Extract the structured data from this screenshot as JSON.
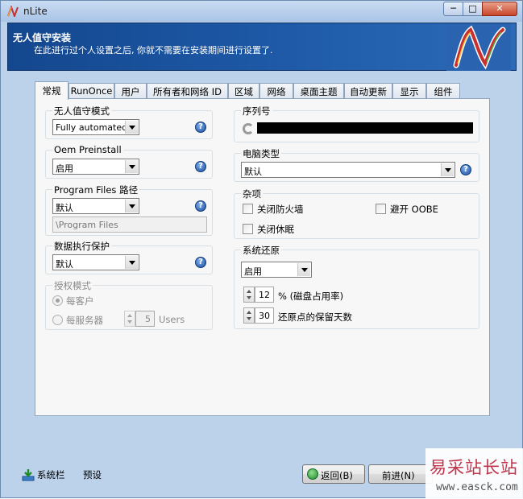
{
  "window": {
    "title": "nLite",
    "min_glyph": "─",
    "max_glyph": "□",
    "close_glyph": "✕"
  },
  "banner": {
    "title": "无人值守安装",
    "subtitle": "在此进行过个人设置之后, 你就不需要在安装期间进行设置了."
  },
  "tabs": [
    "常规",
    "RunOnce",
    "用户",
    "所有者和网络 ID",
    "区域",
    "网络",
    "桌面主题",
    "自动更新",
    "显示",
    "组件"
  ],
  "left": {
    "unattended_mode": {
      "label": "无人值守模式",
      "value": "Fully automated"
    },
    "oem_preinstall": {
      "label": "Oem Preinstall",
      "value": "启用"
    },
    "program_files": {
      "label": "Program Files 路径",
      "value": "默认",
      "path": "\\Program Files"
    },
    "dep": {
      "label": "数据执行保护",
      "value": "默认"
    },
    "license": {
      "label": "授权模式",
      "per_seat": "每客户",
      "per_server": "每服务器",
      "users_count": "5",
      "users_label": "Users"
    }
  },
  "right": {
    "serial": {
      "label": "序列号"
    },
    "computer_type": {
      "label": "电脑类型",
      "value": "默认"
    },
    "misc": {
      "label": "杂项",
      "firewall": "关闭防火墙",
      "oobe": "避开 OOBE",
      "hibernate": "关闭休眠"
    },
    "system_restore": {
      "label": "系统还原",
      "value": "启用",
      "disk_percent": "12",
      "disk_percent_label": "% (磁盘占用率)",
      "keep_days": "30",
      "keep_days_label": "还原点的保留天数"
    }
  },
  "bottom": {
    "tray_label": "系统栏",
    "preset_label": "预设",
    "back_label": "返回(B)",
    "next_label": "前进(N)"
  },
  "watermark": {
    "line1": "易采站长站",
    "line2": "www.easck.com"
  },
  "help_glyph": "?",
  "colors": {
    "banner": "#1e5aa8",
    "window_bg": "#bcd2ea",
    "tab_page": "#f7f7f7",
    "help": "#1c4d9e",
    "watermark": "#c0354a"
  }
}
